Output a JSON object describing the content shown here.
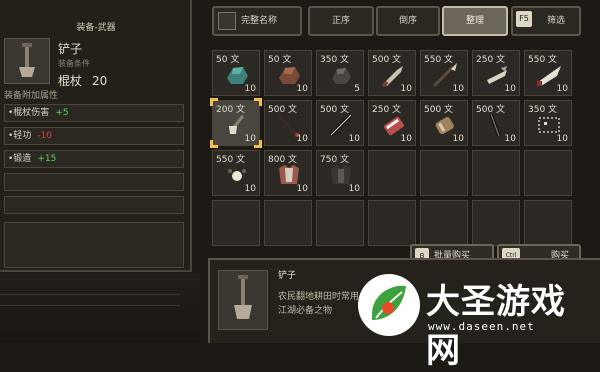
{
  "left": {
    "title": "装备-武器",
    "item_name": "铲子",
    "item_req": "装备条件",
    "item_stat_label": "棍杖",
    "item_stat_value": "20",
    "attr_title": "装备附加属性",
    "attrs": [
      {
        "name": "•棍杖伤害",
        "value": "+5",
        "type": "plus"
      },
      {
        "name": "•轻功",
        "value": "-10",
        "type": "minus"
      },
      {
        "name": "•锻造",
        "value": "+15",
        "type": "plus"
      }
    ]
  },
  "toolbar": {
    "full_name": "完整名称",
    "forward": "正序",
    "reverse": "倒序",
    "arrange": "整理",
    "filter_key": "F5",
    "filter": "筛选"
  },
  "shop": {
    "items": [
      {
        "price": "50 文",
        "qty": "10",
        "icon": "ore-teal-icon"
      },
      {
        "price": "50 文",
        "qty": "10",
        "icon": "ore-brown-icon"
      },
      {
        "price": "350 文",
        "qty": "5",
        "icon": "ore-dark-icon"
      },
      {
        "price": "500 文",
        "qty": "10",
        "icon": "knife-icon"
      },
      {
        "price": "550 文",
        "qty": "10",
        "icon": "spear-icon"
      },
      {
        "price": "250 文",
        "qty": "10",
        "icon": "claw-icon"
      },
      {
        "price": "550 文",
        "qty": "10",
        "icon": "blade-icon"
      },
      {
        "price": "200 文",
        "qty": "10",
        "icon": "shovel-icon",
        "selected": true
      },
      {
        "price": "500 文",
        "qty": "10",
        "icon": "staff-icon"
      },
      {
        "price": "500 文",
        "qty": "10",
        "icon": "rod-icon"
      },
      {
        "price": "250 文",
        "qty": "10",
        "icon": "scroll-icon"
      },
      {
        "price": "500 文",
        "qty": "10",
        "icon": "bracer-icon"
      },
      {
        "price": "500 文",
        "qty": "10",
        "icon": "pole-icon"
      },
      {
        "price": "350 文",
        "qty": "10",
        "icon": "chain-icon"
      },
      {
        "price": "550 文",
        "qty": "10",
        "icon": "hairpin-icon"
      },
      {
        "price": "800 文",
        "qty": "10",
        "icon": "armor-icon"
      },
      {
        "price": "750 文",
        "qty": "10",
        "icon": "robe-icon"
      }
    ]
  },
  "actions": {
    "bulk_key": "B",
    "bulk": "批量购买",
    "buy_key": "Ctrl",
    "buy": "购买"
  },
  "detail": {
    "name": "铲子",
    "desc": "农民翻地耕田时常用，走江湖必备之物"
  },
  "watermark": {
    "title": "大圣游戏网",
    "url": "www.daseen.net"
  }
}
